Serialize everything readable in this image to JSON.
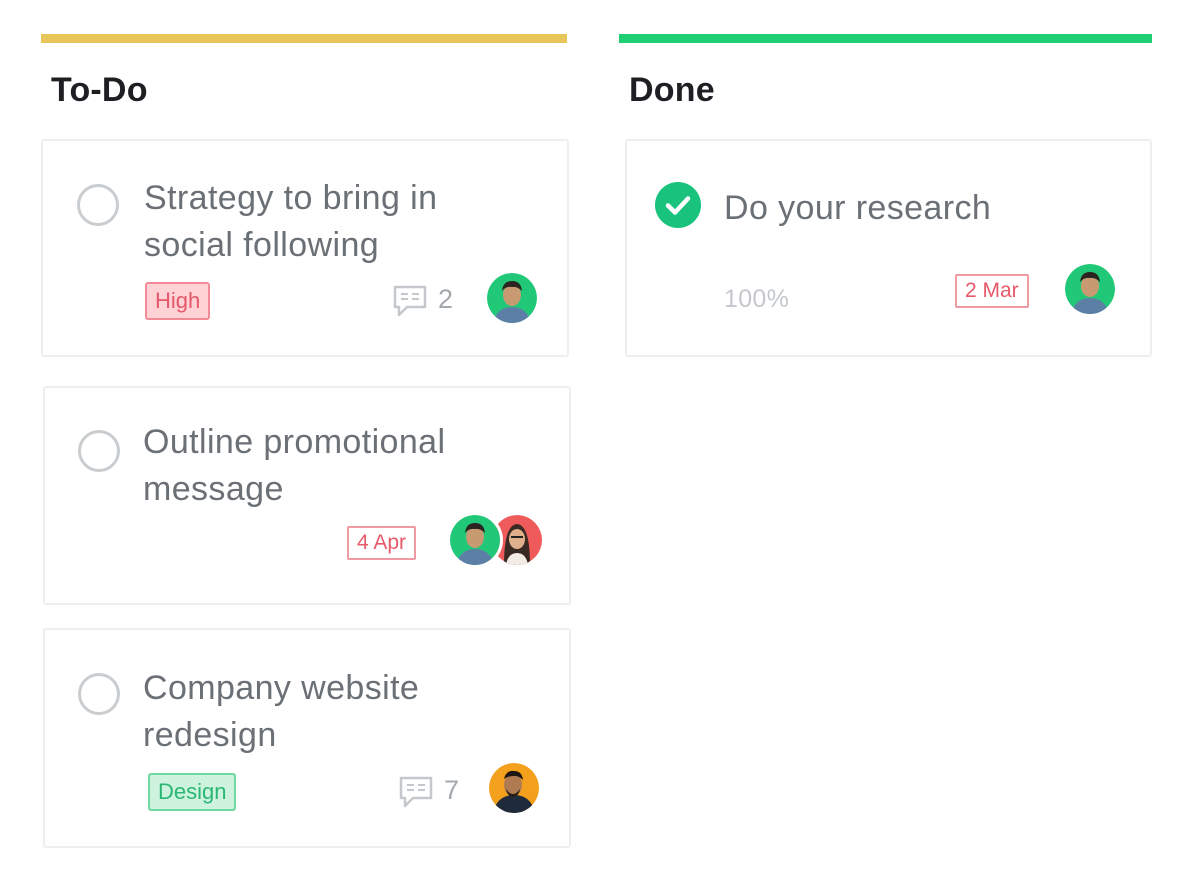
{
  "colors": {
    "todo_bar": "#e8c65a",
    "done_bar": "#1fcf73",
    "tag_high": "#e5576a",
    "tag_design": "#2cb673",
    "done_check": "#19c37d"
  },
  "columns": [
    {
      "title": "To-Do",
      "cards": [
        {
          "title_line1": "Strategy to bring in",
          "title_line2": "social following",
          "tag": "High",
          "comments": "2",
          "avatar_icons": [
            "avatar-man-green"
          ]
        },
        {
          "title_line1": "Outline promotional",
          "title_line2": "message",
          "due_date": "4 Apr",
          "avatar_icons": [
            "avatar-man-green",
            "avatar-woman-red"
          ]
        },
        {
          "title_line1": "Company website",
          "title_line2": "redesign",
          "tag": "Design",
          "comments": "7",
          "avatar_icons": [
            "avatar-man-orange"
          ]
        }
      ]
    },
    {
      "title": "Done",
      "cards": [
        {
          "title_line1": "Do your research",
          "progress": "100%",
          "due_date": "2 Mar",
          "completed": true,
          "avatar_icons": [
            "avatar-man-green"
          ]
        }
      ]
    }
  ]
}
